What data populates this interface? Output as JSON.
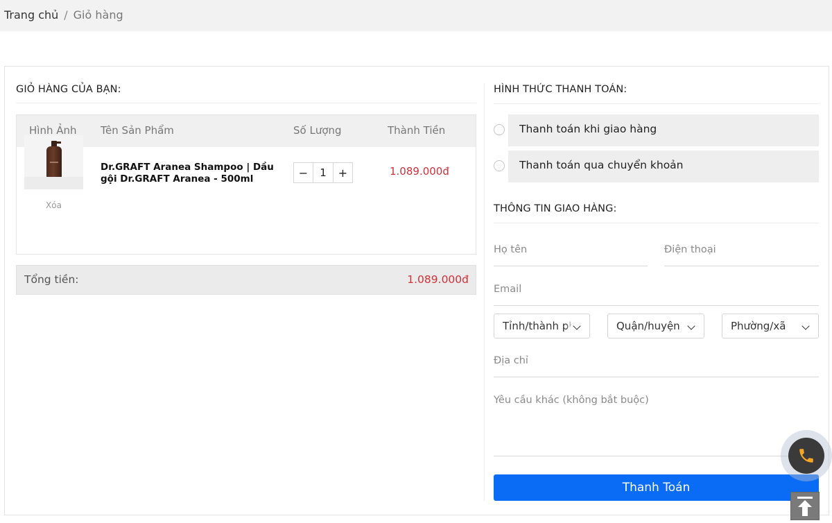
{
  "breadcrumb": {
    "home": "Trang chủ",
    "separator": "/",
    "current": "Giỏ hàng"
  },
  "cart": {
    "title": "GIỎ HÀNG CỦA BẠN:",
    "columns": [
      "Hình Ảnh",
      "Tên Sản Phẩm",
      "Số Lượng",
      "Thành Tiền"
    ],
    "items": [
      {
        "name": "Dr.GRAFT Aranea Shampoo | Dầu gội Dr.GRAFT Aranea - 500ml",
        "delete_label": "Xóa",
        "minus": "−",
        "quantity": "1",
        "plus": "+",
        "line_total": "1.089.000đ"
      }
    ],
    "total_label": "Tổng tiền:",
    "total_value": "1.089.000đ"
  },
  "payment": {
    "title": "HÌNH THỨC THANH TOÁN:",
    "options": [
      "Thanh toán khi giao hàng",
      "Thanh toán qua chuyển khoản"
    ]
  },
  "shipping": {
    "title": "THÔNG TIN GIAO HÀNG:",
    "name_placeholder": "Họ tên",
    "phone_placeholder": "Điện thoại",
    "email_placeholder": "Email",
    "province": "Tỉnh/thành phố",
    "district": "Quận/huyện",
    "ward": "Phường/xã",
    "address_placeholder": "Địa chỉ",
    "note_placeholder": "Yêu cầu khác (không bắt buộc)"
  },
  "submit_label": "Thanh Toán",
  "colors": {
    "accent": "#0a6cf5",
    "price": "#d2313a",
    "phone": "#f5a623"
  },
  "icons": {
    "phone": "phone-icon",
    "scroll_top": "arrow-up-icon"
  }
}
